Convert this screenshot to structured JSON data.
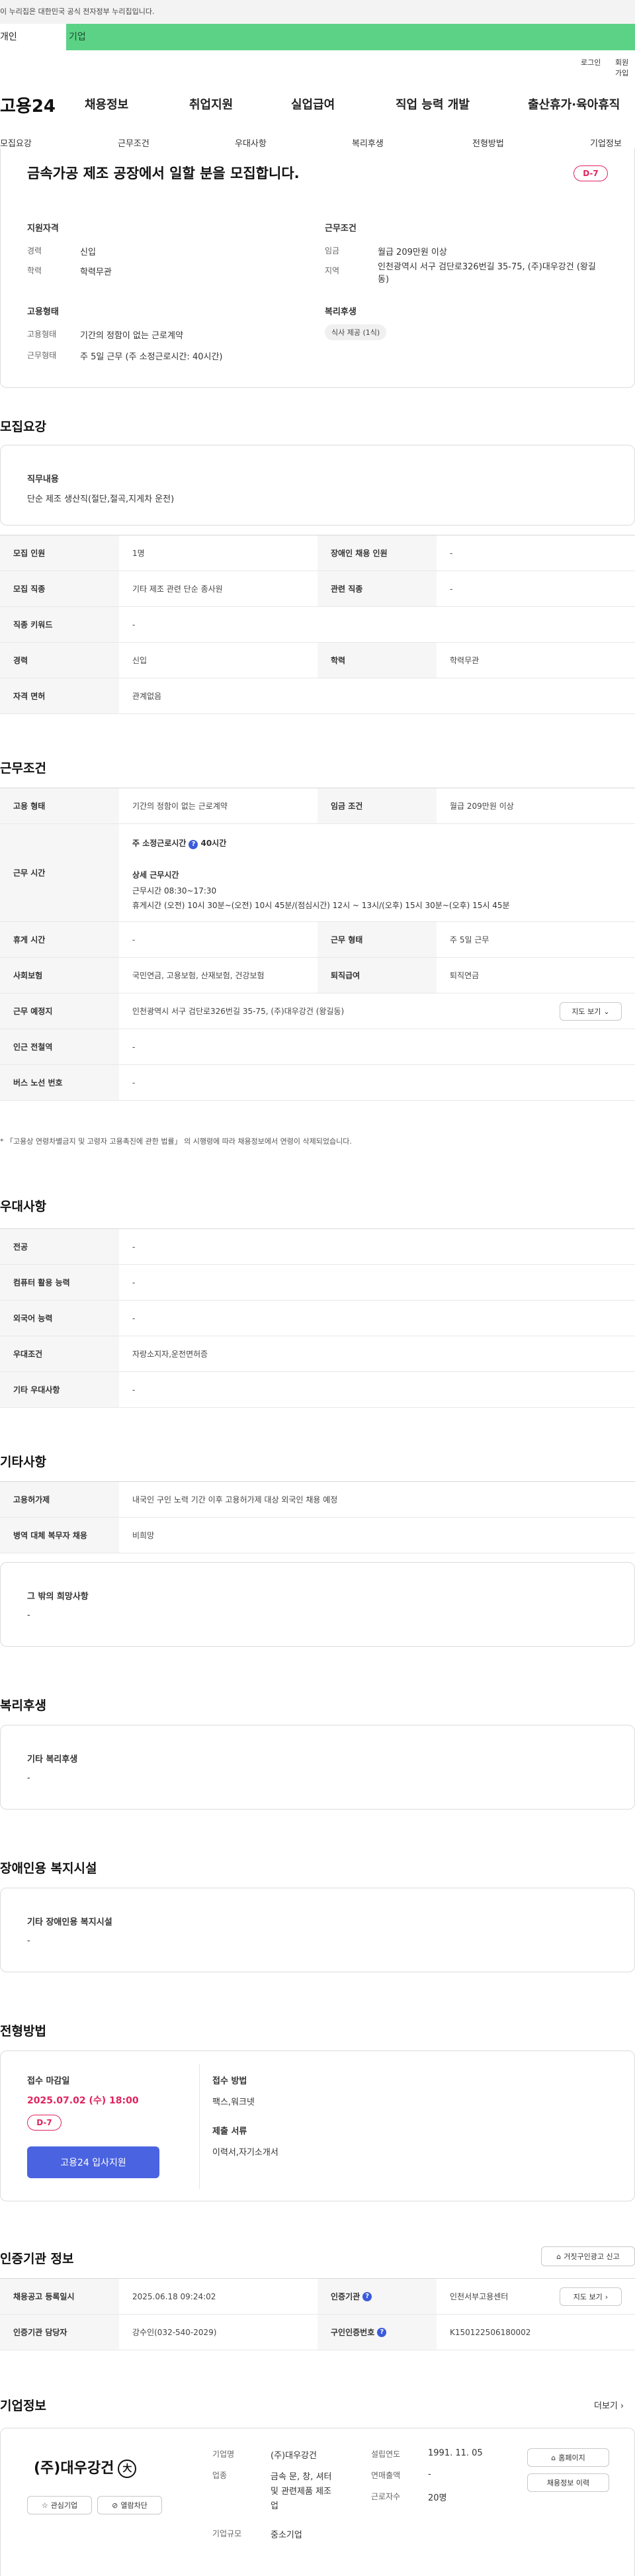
{
  "gov_banner": "이 누리집은 대한민국 공식 전자정부 누리집입니다.",
  "top_tabs": {
    "personal": "개인",
    "company": "기업"
  },
  "util": {
    "login": "로그인",
    "join": "회원가입"
  },
  "logo": "고용24",
  "gnb": [
    "채용정보",
    "취업지원",
    "실업급여",
    "직업 능력 개발",
    "출산휴가·육아휴직"
  ],
  "snb": [
    "모집요강",
    "근무조건",
    "우대사항",
    "복리후생",
    "전형방법",
    "기업정보"
  ],
  "summary": {
    "title": "금속가공 제조 공장에서 일할 분을 모집합니다.",
    "dday": "D-7",
    "qual_title": "지원자격",
    "career_l": "경력",
    "career_v": "신입",
    "edu_l": "학력",
    "edu_v": "학력무관",
    "emp_title": "고용형태",
    "emptype_l": "고용형태",
    "emptype_v": "기간의 정함이 없는 근로계약",
    "worktype_l": "근무형태",
    "worktype_v": "주 5일 근무 (주 소정근로시간: 40시간)",
    "cond_title": "근무조건",
    "wage_l": "임금",
    "wage_v": "월급 209만원 이상",
    "region_l": "지역",
    "region_v": "인천광역시 서구 검단로326번길 35-75, (주)대우강건 (왕길동)",
    "welfare_title": "복리후생",
    "welfare_tag": "식사 제공 (1식)"
  },
  "recruit": {
    "title": "모집요강",
    "duty_title": "직무내용",
    "duty_v": "단순 제조 생산직(절단,절곡,지게차 운전)",
    "rows": [
      {
        "l1": "모집 인원",
        "v1": "1명",
        "l2": "장애인 채용 인원",
        "v2": "-"
      },
      {
        "l1": "모집 직종",
        "v1": "기타 제조 관련 단순 종사원",
        "l2": "관련 직종",
        "v2": "-"
      },
      {
        "l1": "직종 키워드",
        "v1": "-"
      },
      {
        "l1": "경력",
        "v1": "신입",
        "l2": "학력",
        "v2": "학력무관"
      },
      {
        "l1": "자격 면허",
        "v1": "관계없음"
      }
    ]
  },
  "work": {
    "title": "근무조건",
    "r1": {
      "l1": "고용 형태",
      "v1": "기간의 정함이 없는 근로계약",
      "l2": "임금 조건",
      "v2": "월급 209만원 이상"
    },
    "time_l": "근무 시간",
    "time_week": "주 소정근로시간",
    "time_week_v": "40시간",
    "time_detail_t": "상세 근무시간",
    "time_detail_1": "근무시간 08:30~17:30",
    "time_detail_2": "휴게시간 (오전) 10시 30분~(오전) 10시 45분/(점심시간) 12시 ~ 13시/(오후) 15시 30분~(오후) 15시 45분",
    "r3": {
      "l1": "휴게 시간",
      "v1": "-",
      "l2": "근무 형태",
      "v2": "주 5일 근무"
    },
    "r4": {
      "l1": "사회보험",
      "v1": "국민연금, 고용보험, 산재보험, 건강보험",
      "l2": "퇴직급여",
      "v2": "퇴직연금"
    },
    "r5": {
      "l1": "근무 예정지",
      "v1": "인천광역시 서구 검단로326번길 35-75, (주)대우강건 (왕길동)",
      "btn": "지도 보기"
    },
    "r6": {
      "l1": "인근 전철역",
      "v1": "-"
    },
    "r7": {
      "l1": "버스 노선 번호",
      "v1": "-"
    },
    "note": "* 「고용상 연령차별금지 및 고령자 고용촉진에 관한 법률」 의 시행령에 따라 채용정보에서 연령이 삭제되었습니다."
  },
  "pref": {
    "title": "우대사항",
    "rows": [
      {
        "l": "전공",
        "v": "-"
      },
      {
        "l": "컴퓨터 활용 능력",
        "v": "-"
      },
      {
        "l": "외국어 능력",
        "v": "-"
      },
      {
        "l": "우대조건",
        "v": "자랑소지자,운전면허증"
      },
      {
        "l": "기타 우대사항",
        "v": "-"
      }
    ]
  },
  "etc": {
    "title": "기타사항",
    "rows": [
      {
        "l": "고용허가제",
        "v": "내국인 구인 노력 기간 이후 고용허가제 대상 외국인 채용 예정"
      },
      {
        "l": "병역 대체 복무자 채용",
        "v": "비희망"
      }
    ],
    "box_title": "그 밖의 희망사항",
    "box_v": "-"
  },
  "welfare": {
    "title": "복리후생",
    "box_title": "기타 복리후생",
    "box_v": "-"
  },
  "disabled": {
    "title": "장애인용 복지시설",
    "box_title": "기타 장애인용 복지시설",
    "box_v": "-"
  },
  "process": {
    "title": "전형방법",
    "deadline_t": "접수 마감일",
    "deadline_v": "2025.07.02 (수) 18:00",
    "dday": "D-7",
    "apply_btn": "고용24 입사지원",
    "method_t": "접수 방법",
    "method_v": "팩스,워크넷",
    "docs_t": "제출 서류",
    "docs_v": "이력서,자기소개서"
  },
  "cert": {
    "title": "인증기관 정보",
    "report_btn": "거짓구인광고 신고",
    "r1": {
      "l1": "채용공고 등록일시",
      "v1": "2025.06.18 09:24:02",
      "l2": "인증기관",
      "v2": "인천서부고용센터",
      "btn": "지도 보기"
    },
    "r2": {
      "l1": "인증기관 담당자",
      "v1": "강수인(032-540-2029)",
      "l2": "구인인증번호",
      "v2": "K150122506180002"
    }
  },
  "company": {
    "title": "기업정보",
    "more": "더보기",
    "logo_text": "(주)대우강건",
    "fav_btn": "관심기업",
    "block_btn": "열람차단",
    "name_l": "기업명",
    "name_v": "(주)대우강건",
    "ind_l": "업종",
    "ind_v1": "금속 문, 창, 셔터",
    "ind_v2": "및 관련제품 제조",
    "ind_v3": "업",
    "size_l": "기업규모",
    "size_v": "중소기업",
    "est_l": "설립연도",
    "est_v": "1991. 11. 05",
    "sales_l": "연매출액",
    "sales_v": "-",
    "emp_l": "근로자수",
    "emp_v": "20명",
    "home_btn": "홈페이지",
    "hist_btn": "채용정보 이력"
  },
  "colors": {
    "green": "#5cd286",
    "pink": "#e0245e",
    "blue": "#4a63e0"
  }
}
